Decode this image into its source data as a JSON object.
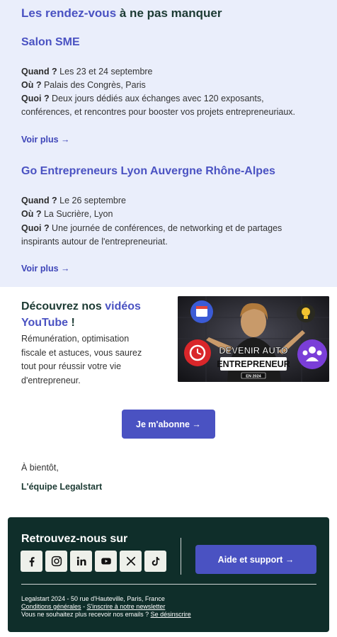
{
  "events": {
    "title_accent": "Les rendez-vous",
    "title_rest": " à ne pas manquer",
    "items": [
      {
        "name": "Salon SME",
        "when_label": "Quand ?",
        "when": " Les 23 et 24 septembre",
        "where_label": "Où ?",
        "where": " Palais des Congrès, Paris",
        "what_label": "Quoi ?",
        "what_line1": " Deux jours dédiés aux échanges avec 120 exposants,",
        "what_line2": "conférences, et rencontres pour booster vos projets entrepreneuriaux.",
        "more": "Voir plus →"
      },
      {
        "name": "Go Entrepreneurs Lyon Auvergne Rhône-Alpes",
        "when_label": "Quand ?",
        "when": " Le 26 septembre",
        "where_label": "Où ?",
        "where": " La Sucrière, Lyon",
        "what_label": "Quoi ?",
        "what_line1": " Une journée de conférences, de networking et de partages",
        "what_line2": "inspirants autour de l'entrepreneuriat.",
        "more": "Voir plus →"
      }
    ]
  },
  "youtube": {
    "title_start": "Découvrez nos ",
    "title_accent": "vidéos YouTube",
    "title_end": " !",
    "description": "Rémunération, optimisation fiscale et astuces, vous saurez tout pour réussir votre vie d'entrepreneur.",
    "thumbnail_line1": "DEVENIR AUTO",
    "thumbnail_line2": "ENTREPRENEUR",
    "thumbnail_badge": "EN 2024",
    "subscribe_label": "Je m'abonne →"
  },
  "signoff": {
    "greeting": "À bientôt,",
    "team": "L'équipe Legalstart"
  },
  "footer": {
    "title": "Retrouvez-nous sur",
    "socials": [
      "facebook-icon",
      "instagram-icon",
      "linkedin-icon",
      "youtube-icon",
      "x-icon",
      "tiktok-icon"
    ],
    "support_label": "Aide et support →",
    "address": "Legalstart 2024 - 50 rue d'Hauteville, Paris, France",
    "terms_link": "Conditions générales",
    "separator": " - ",
    "newsletter_link": "S'inscrire à notre newsletter",
    "unsubscribe_text": "Vous ne souhaitez plus recevoir nos emails ? ",
    "unsubscribe_link": "Se désinscrire"
  },
  "colors": {
    "accent": "#4a52c2",
    "dark_green": "#0f2e2a",
    "event_bg": "#eaeefb"
  }
}
